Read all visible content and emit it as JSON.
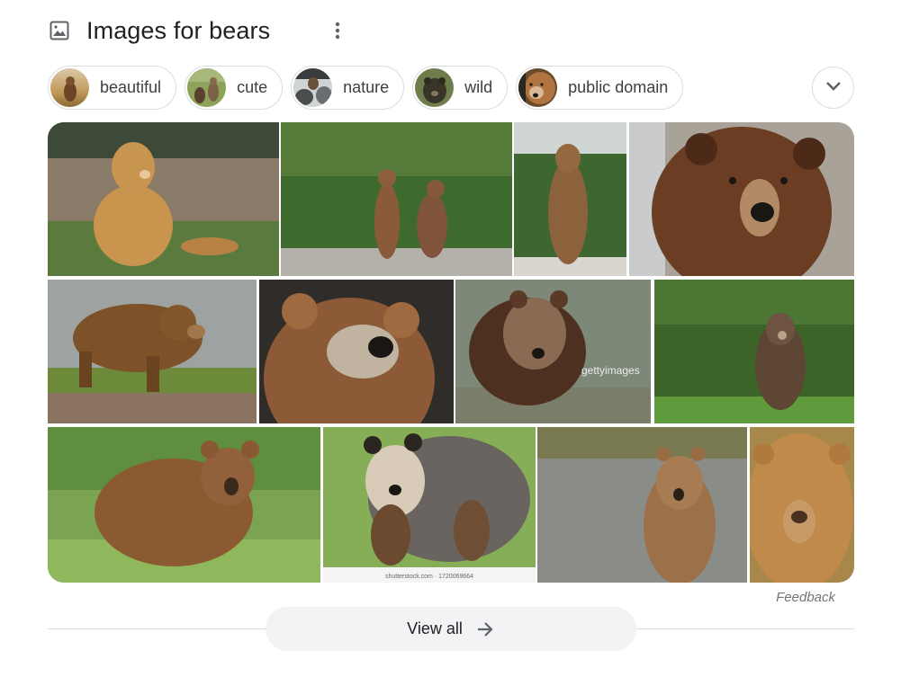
{
  "header": {
    "icon": "image-icon",
    "title": "Images for bears",
    "menu_icon": "more-vert-icon"
  },
  "chips": [
    {
      "label": "beautiful",
      "thumb": "bear-in-field-thumbnail"
    },
    {
      "label": "cute",
      "thumb": "bear-cubs-thumbnail"
    },
    {
      "label": "nature",
      "thumb": "bear-in-waterfall-thumbnail"
    },
    {
      "label": "wild",
      "thumb": "dark-bear-thumbnail"
    },
    {
      "label": "public domain",
      "thumb": "bear-face-thumbnail"
    }
  ],
  "expand_icon": "chevron-down-icon",
  "images": [
    {
      "alt": "Brown bear sitting in grass by a fence"
    },
    {
      "alt": "Two bear cubs playing on gravel"
    },
    {
      "alt": "Bear standing upright in forest"
    },
    {
      "alt": "Close-up of a brown bear face"
    },
    {
      "alt": "Brown bear walking on dirt in fog"
    },
    {
      "alt": "Close-up of a bear looking up"
    },
    {
      "alt": "Brown bear walking toward camera",
      "watermark": "gettyimages"
    },
    {
      "alt": "Bear standing in green forest"
    },
    {
      "alt": "Brown bear standing in tall grass"
    },
    {
      "alt": "Grizzly mother with two cubs",
      "caption": "shutterstock.com · 1720069664"
    },
    {
      "alt": "Bear standing in shallow river"
    },
    {
      "alt": "Close-up of golden bear face"
    }
  ],
  "feedback_label": "Feedback",
  "view_all": {
    "label": "View all",
    "icon": "arrow-right-icon"
  }
}
